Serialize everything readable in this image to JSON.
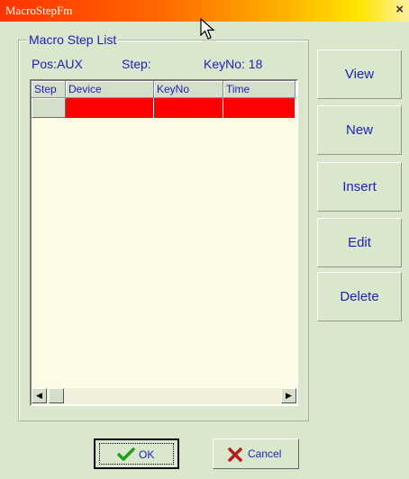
{
  "window": {
    "title": "MacroStepFm",
    "close_glyph": "×"
  },
  "group": {
    "label": "Macro Step List",
    "pos_text": "Pos:AUX",
    "step_text": "Step:",
    "keyno_text": "KeyNo: 18"
  },
  "table": {
    "columns": [
      "Step",
      "Device",
      "KeyNo",
      "Time"
    ],
    "rows": [
      {
        "selected": true,
        "cells": [
          "",
          "",
          "",
          ""
        ]
      }
    ]
  },
  "buttons": {
    "view": "View",
    "new": "New",
    "insert": "Insert",
    "edit": "Edit",
    "delete": "Delete",
    "ok": "OK",
    "cancel": "Cancel"
  },
  "colors": {
    "background": "#d9e7cd",
    "label_text": "#1e1ebf",
    "selected_row": "#ff0000",
    "grid_background": "#fbfbe6",
    "ok_icon": "#1f9e1f",
    "cancel_icon": "#b31d1d"
  },
  "icons": {
    "ok": "check-icon",
    "cancel": "x-icon",
    "scroll_left": "scroll-left-icon",
    "scroll_right": "scroll-right-icon"
  }
}
